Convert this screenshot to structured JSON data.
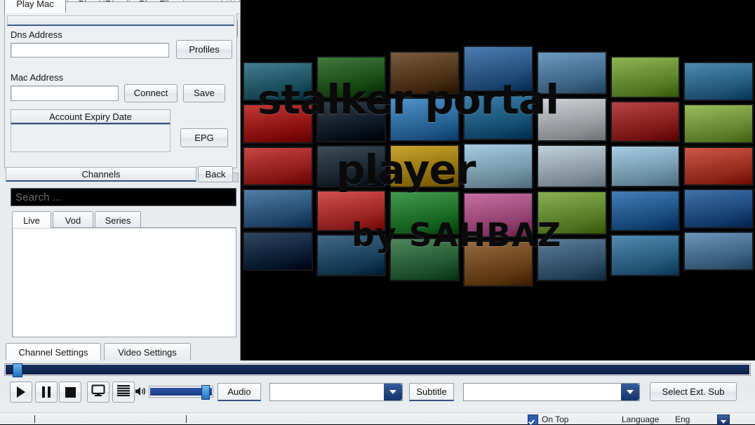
{
  "app": {
    "title": "stalker portal player",
    "accent": "#16336a",
    "panel_bg": "#edf0f3"
  },
  "top_tabs": [
    {
      "label": "Play Mac",
      "active": true
    },
    {
      "label": "Play URL",
      "active": false
    },
    {
      "label": "Play File",
      "active": false
    }
  ],
  "top_icons": {
    "gear": "gear-icon",
    "help_label": "?"
  },
  "connection": {
    "dns_label": "Dns Address",
    "dns_value": "",
    "dns_placeholder": "",
    "profiles_button": "Profiles",
    "mac_label": "Mac Address",
    "mac_value": "",
    "mac_placeholder": "",
    "connect_button": "Connect",
    "save_button": "Save",
    "expiry_group_label": "Account Expiry Date",
    "expiry_value": "",
    "epg_button": "EPG"
  },
  "nav": {
    "channels_button": "Channels",
    "back_button": "Back"
  },
  "search": {
    "placeholder": "Search ...",
    "value": ""
  },
  "content_tabs": [
    {
      "label": "Live",
      "active": true
    },
    {
      "label": "Vod",
      "active": false
    },
    {
      "label": "Series",
      "active": false
    }
  ],
  "channel_list": {
    "items": []
  },
  "settings_tabs": [
    {
      "label": "Channel Settings",
      "active": true
    },
    {
      "label": "Video Settings",
      "active": false
    }
  ],
  "video": {
    "line1": "stalker portal",
    "line2": "player",
    "line3": "by SAHBAZ",
    "background": "#000000"
  },
  "player": {
    "seek_position_percent": 1,
    "volume_percent": 92,
    "buttons": [
      {
        "name": "play",
        "glyph": "play"
      },
      {
        "name": "pause",
        "glyph": "pause"
      },
      {
        "name": "stop",
        "glyph": "stop"
      },
      {
        "name": "fullscreen",
        "glyph": "monitor"
      },
      {
        "name": "playlist",
        "glyph": "list"
      }
    ],
    "volume_icon": "speaker-icon",
    "audio_label": "Audio",
    "audio_value": "",
    "subtitle_label": "Subtitle",
    "subtitle_value": "",
    "select_ext_sub_button": "Select Ext. Sub"
  },
  "status": {
    "on_top_label": "On Top",
    "on_top_checked": true,
    "language_label": "Language",
    "language_value": "Eng"
  },
  "screen_wall": {
    "columns": 7,
    "rows": 5,
    "tile_colors": [
      [
        "#2f6f82",
        "#2e6a2a",
        "#6b4a2a",
        "#3a6fa8",
        "#5d8fb8",
        "#7fae3f",
        "#3b7ea8"
      ],
      [
        "#bb2222",
        "#1d2a38",
        "#3e86c4",
        "#29719e",
        "#c8cdd2",
        "#b03030",
        "#8db64a"
      ],
      [
        "#c13030",
        "#2b3a46",
        "#c39a1c",
        "#9fc6de",
        "#b9ccd8",
        "#9dc8e2",
        "#c84434"
      ],
      [
        "#3e6f9c",
        "#cf3c3c",
        "#2f8f3c",
        "#c25f9a",
        "#7aa93f",
        "#2f6fae",
        "#2d62a0"
      ],
      [
        "#1a3350",
        "#2d5a7a",
        "#3a7a4a",
        "#8b5a2a",
        "#4a6e8c",
        "#3f7fa8",
        "#5c8ab0"
      ]
    ]
  }
}
